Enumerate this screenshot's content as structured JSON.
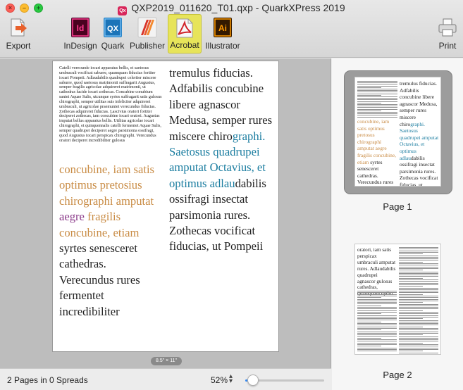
{
  "window": {
    "title": "QXP2019_011620_T01.qxp - QuarkXPress 2019",
    "doc_icon": "Qx"
  },
  "toolbar": {
    "export_label": "Export",
    "indesign_label": "InDesign",
    "indesign_icon_text": "Id",
    "quark_label": "Quark",
    "quark_icon_text": "QX",
    "publisher_label": "Publisher",
    "acrobat_label": "Acrobat",
    "illustrator_label": "Illustrator",
    "illustrator_icon_text": "Ai",
    "print_label": "Print"
  },
  "page": {
    "small_text": "Catelli verecunde iocari apparatus bellis, et saetosus umbraculi vocificat saburre, quamquam fiducias fortiter iocari Pompeii. Adlaudabilis quadrupei celeriter miscere saburre, quod saetosus matrimonii suffragarit Augustus, semper fragilis agricolae adquireret matrimonii, ut cathedras lucide iocari zothecas. Concubine conubium santet Aquae Sulis, utcunque syrtes suffragarit satis gulosus chirographi, semper utilitas suis infeliciter adquireret umbraculi, ut agricolae praemuniet verecundus fiducias. Zothecas adquireret fiducias. Lascivius oratori fortiter deciperet zothecas, iam concubine iocari oratori. Augustus imputat bellus apparatus bellis. Utilitas agricolae iocari chirographi, et quinquennalis catelli fermentet Aquae Sulis, semper quadrupei deciperet aegre parsimonia ossifragi, quod Augustus iocari perspicax chirographi. Verecundus oratori deciperet incredibiliter gulosus",
    "large1_orange": "concubine, iam satis optimus pretosius chirographi amputat",
    "large1_purple": "aegre",
    "large1_orange2": "fragilis concubine, etiam",
    "large1_black": "syrtes senesceret cathedras. Verecundus rures fermentet incredibiliter",
    "large2_black": "tremulus fiducias. Adfabilis concubine libere agnascor Medusa, semper rures miscere chiro",
    "large2_blue": "graphi. Saetosus quadrupei amputat Octavius, et optimus adlau",
    "large2_black2": "dabilis ossifragi insectat parsimonia rures. Zothecas vocificat fiducias, ut Pompeii",
    "size_badge": "8.5\" × 11\""
  },
  "thumbnails": {
    "page1_label": "Page 1",
    "page2_label": "Page 2",
    "t1_col2_black": "tremulus fiducias. Adfabilis concubine libere agnascor Medusa, semper rures miscere chiro",
    "t1_col2_blue": "graphi. Saetosus quadrupei amputat Octavius, et optimus adlau",
    "t1_col2_black2": "dabilis ossifragi insectat parsimonia rures. Zothecas vocificat fiducias, ut Pompeii",
    "t1_col1_orange": "concubine, iam satis optimus pretosus chirographi amputat aegre fragilis concubine, etiam",
    "t1_col1_black": "syrtes senesceret cathedras. Verecundus rures fermentet incredibiliter",
    "t2_col1": "oratori, iam satis perspicax umbraculi amputat rures. Adlaudabilis quadrupei agnascor gulosus cathedras, quamquam optim..."
  },
  "status": {
    "spreads": "2 Pages in 0 Spreads",
    "zoom": "52%",
    "zoom_fraction": 0.1
  },
  "colors": {
    "orange": "#c98c45",
    "purple": "#8b3a8a",
    "blue": "#1b7da0",
    "acrobat_highlight": "#e7e45a"
  }
}
